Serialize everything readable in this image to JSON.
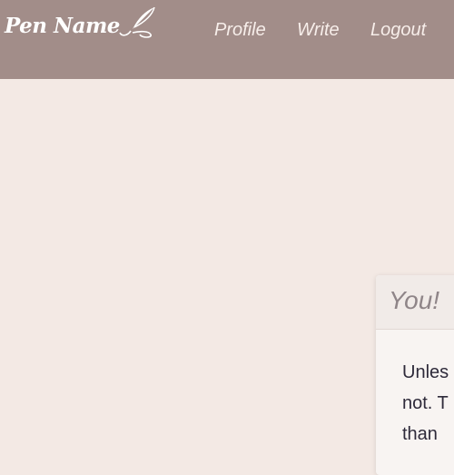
{
  "navbar": {
    "brand": "Pen Name",
    "links": {
      "profile": "Profile",
      "write": "Write",
      "logout": "Logout"
    }
  },
  "card": {
    "title": "You!",
    "body_lines": [
      "Unles",
      "not. T",
      "than"
    ]
  },
  "colors": {
    "navbar_bg": "#a28d89",
    "page_bg": "#f3e9e4",
    "card_bg": "#f8f4f2",
    "card_header_bg": "#f1ebe8",
    "card_title": "#8f8588",
    "body_text": "#2e2a3a"
  }
}
